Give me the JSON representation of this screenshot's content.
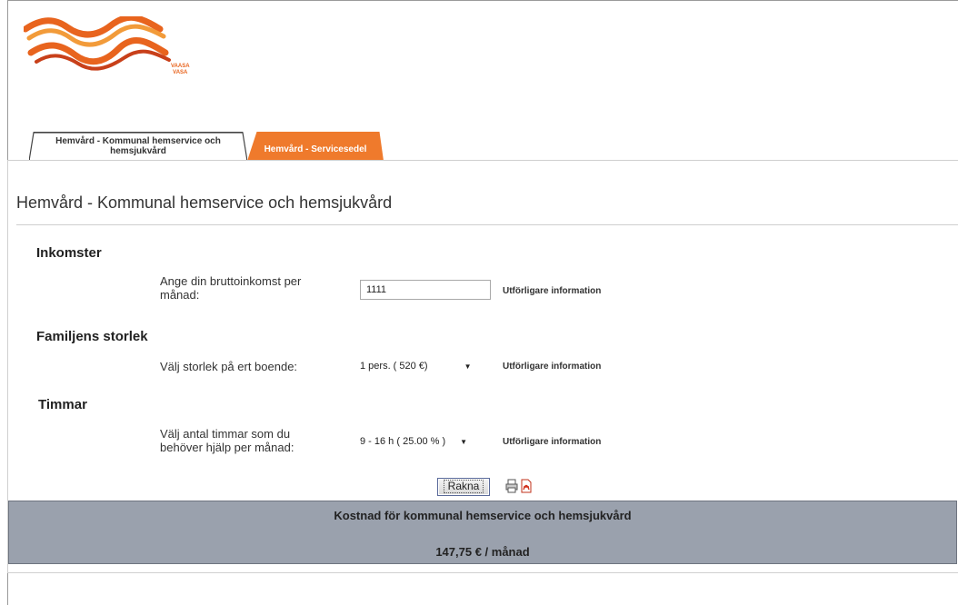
{
  "header": {
    "logo_text_line1": "VAASA",
    "logo_text_line2": "VASA"
  },
  "tabs": [
    {
      "label_line1": "Hemvård - Kommunal hemservice och",
      "label_line2": "hemsjukvård",
      "active": true
    },
    {
      "label": "Hemvård - Servicesedel",
      "active": false
    }
  ],
  "page": {
    "title": "Hemvård - Kommunal hemservice och hemsjukvård"
  },
  "sections": {
    "income": {
      "heading": "Inkomster",
      "label_line1": "Ange din bruttoinkomst per",
      "label_line2": "månad:",
      "value": "1111",
      "more_info": "Utförligare information"
    },
    "family": {
      "heading": "Familjens storlek",
      "label": "Välj storlek på ert boende:",
      "selected": "1 pers. ( 520 €)",
      "more_info": "Utförligare information"
    },
    "hours": {
      "heading": "Timmar",
      "label_line1": "Välj antal timmar som du",
      "label_line2": "behöver hjälp per månad:",
      "selected": "9 - 16 h ( 25.00 % )",
      "more_info": "Utförligare information"
    }
  },
  "actions": {
    "calculate_label": "Rakna"
  },
  "result": {
    "title": "Kostnad för kommunal hemservice och hemsjukvård",
    "value": "147,75 € / månad"
  },
  "colors": {
    "accent": "#ef7a2c",
    "result_bg": "#9aa1ad"
  }
}
